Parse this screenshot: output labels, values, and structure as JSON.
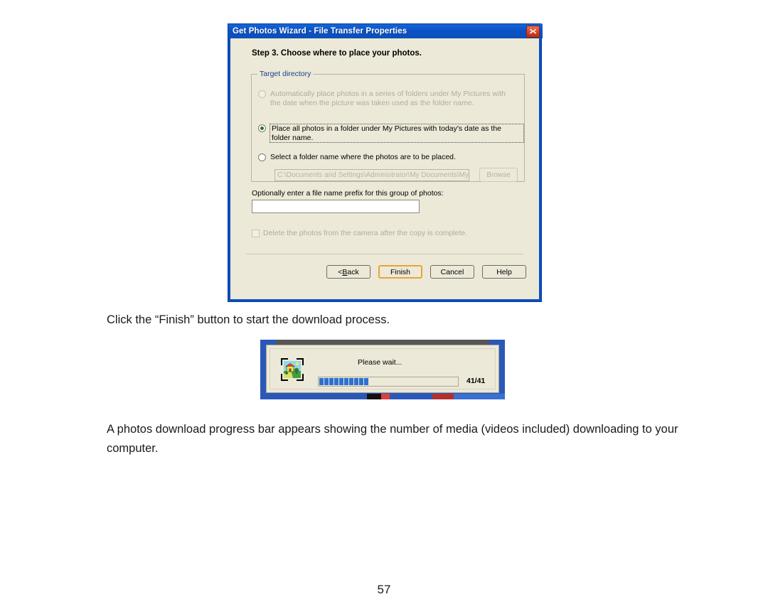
{
  "document": {
    "paragraphs": [
      "Click the “Finish” button to start the download process.",
      "A photos download progress bar appears showing the number of media (videos included) downloading to your computer."
    ],
    "page_number": "57"
  },
  "wizard_dialog": {
    "title": "Get Photos Wizard - File Transfer Properties",
    "close_icon": "close-icon",
    "step_title": "Step 3. Choose where to place your photos.",
    "groupbox": {
      "legend": "Target directory",
      "options": [
        {
          "label": "Automatically place photos in a series of folders under My Pictures with\nthe date when the picture was taken used as the folder name.",
          "selected": false,
          "disabled": true,
          "focused": false
        },
        {
          "label": "Place all photos in a folder under My Pictures with today's date as the folder name.",
          "selected": true,
          "disabled": false,
          "focused": true
        },
        {
          "label": "Select a folder name where the photos are to be placed.",
          "selected": false,
          "disabled": false,
          "focused": false
        }
      ],
      "path_field": {
        "value": "C:\\Documents and Settings\\Administrator\\My Documents\\My Picture",
        "disabled": true
      },
      "browse_label": "Browse"
    },
    "prefix_label": "Optionally enter a file name prefix for this group of photos:",
    "prefix_value": "",
    "prefix_placeholder": "",
    "delete_checkbox": {
      "label": "Delete the photos from the camera after the copy is complete.",
      "checked": false,
      "disabled": true
    },
    "buttons": [
      {
        "label": "< Back",
        "default": false,
        "accelerator": "B"
      },
      {
        "label": "Finish",
        "default": true,
        "accelerator": ""
      },
      {
        "label": "Cancel",
        "default": false,
        "accelerator": ""
      },
      {
        "label": "Help",
        "default": false,
        "accelerator": ""
      }
    ]
  },
  "progress_dialog": {
    "message": "Please wait...",
    "count_text": "41/41",
    "current": 41,
    "total": 41,
    "filled_segments": 10,
    "icon": "photo-thumbnail-icon"
  },
  "colors": {
    "titlebar_blue": "#0a52c6",
    "dialog_face": "#ece9d8",
    "close_red": "#d6452a",
    "progress_blue": "#2f6fd0",
    "default_button_border": "#e8a33d",
    "radio_dot_green": "#1f7a1f",
    "legend_text": "#1b3e8c"
  }
}
